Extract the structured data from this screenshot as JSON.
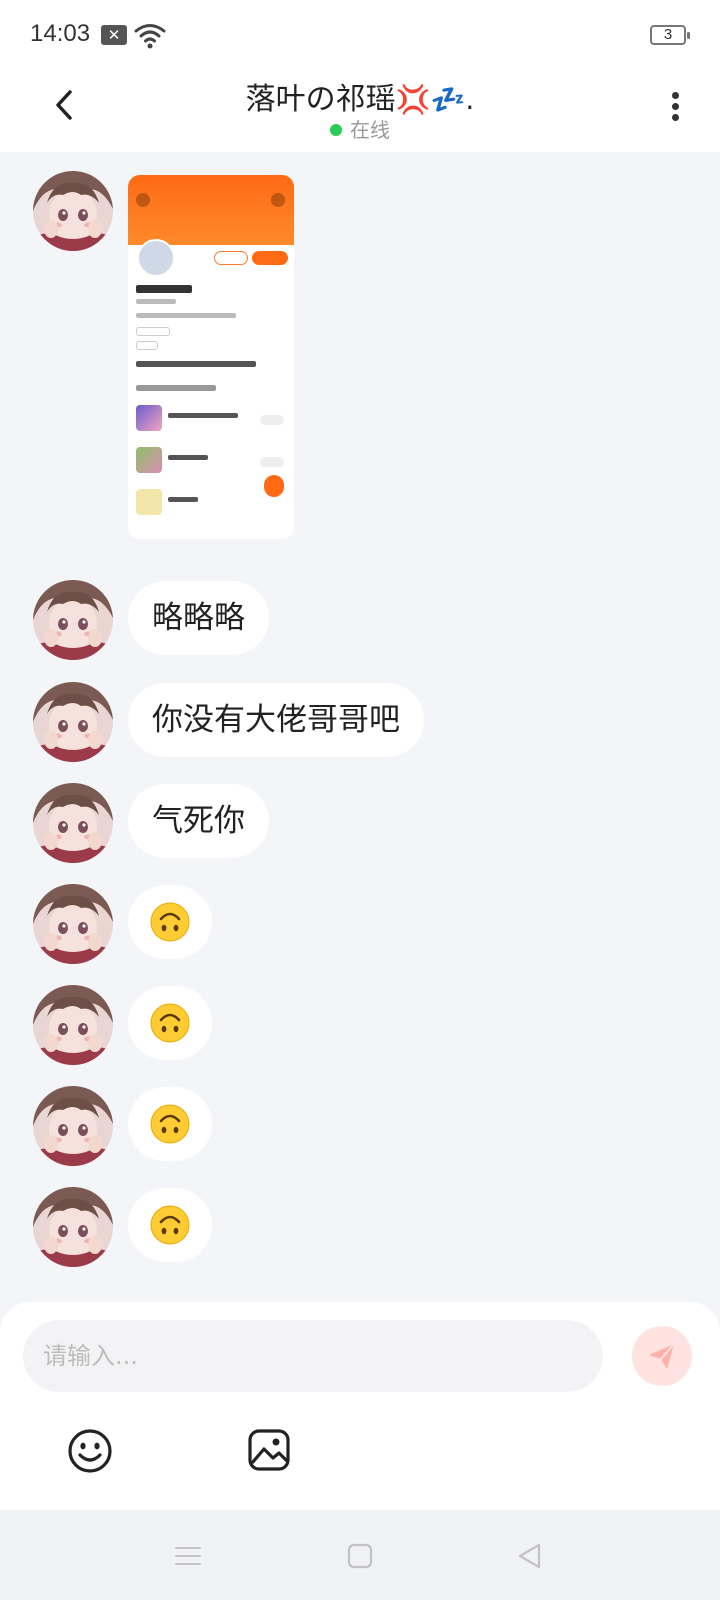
{
  "status_bar": {
    "time": "14:03",
    "battery": "3"
  },
  "header": {
    "title": "落叶の祁瑶",
    "title_emojis": "💢💤.",
    "status": "在线"
  },
  "messages": [
    {
      "type": "image",
      "description": "shared profile screenshot"
    },
    {
      "type": "text",
      "text": "略略略"
    },
    {
      "type": "text",
      "text": "你没有大佬哥哥吧"
    },
    {
      "type": "text",
      "text": "气死你"
    },
    {
      "type": "emoji",
      "icon": "upside-down-face-icon"
    },
    {
      "type": "emoji",
      "icon": "upside-down-face-icon"
    },
    {
      "type": "emoji",
      "icon": "upside-down-face-icon"
    },
    {
      "type": "emoji",
      "icon": "upside-down-face-icon"
    }
  ],
  "composer": {
    "placeholder": "请输入...",
    "value": ""
  },
  "icons": {
    "back": "back-arrow-icon",
    "more": "more-vertical-icon",
    "send": "send-icon",
    "emoji": "smiley-icon",
    "image": "image-icon",
    "nav_menu": "menu-icon",
    "nav_home": "square-home-icon",
    "nav_back": "triangle-back-icon"
  },
  "colors": {
    "online": "#2bcc55",
    "send_button": "#ffe3e1",
    "send_icon": "#ffb0a8",
    "accent_orange": "#ff6a13"
  }
}
